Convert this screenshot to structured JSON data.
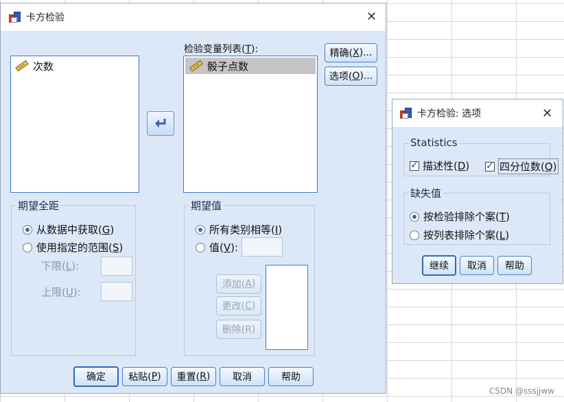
{
  "main_dialog": {
    "title": "卡方检验",
    "source_list": {
      "items": [
        "次数"
      ]
    },
    "test_var_label": "检验变量列表(",
    "test_var_key": "T",
    "test_var_suffix": "):",
    "test_var_list": {
      "items": [
        "骰子点数"
      ]
    },
    "side_buttons": [
      {
        "label": "精确(",
        "key": "X",
        "suffix": ")..."
      },
      {
        "label": "选项(",
        "key": "O",
        "suffix": ")..."
      }
    ],
    "expected_range": {
      "title": "期望全距",
      "option1": {
        "label": "从数据中获取(",
        "key": "G",
        "suffix": ")"
      },
      "option2": {
        "label": "使用指定的范围(",
        "key": "S",
        "suffix": ")"
      },
      "lower": {
        "label": "下限(",
        "key": "L",
        "suffix": "):"
      },
      "upper": {
        "label": "上限(",
        "key": "U",
        "suffix": "):"
      }
    },
    "expected_values": {
      "title": "期望值",
      "option1": {
        "label": "所有类别相等(",
        "key": "I",
        "suffix": ")"
      },
      "option2": {
        "label": "值(",
        "key": "V",
        "suffix": "):"
      },
      "add": {
        "label": "添加(",
        "key": "A",
        "suffix": ")"
      },
      "change": {
        "label": "更改(",
        "key": "C",
        "suffix": ")"
      },
      "remove": {
        "label": "删除(R)"
      }
    },
    "bottom_buttons": {
      "ok": "确定",
      "paste": {
        "label": "粘贴(",
        "key": "P",
        "suffix": ")"
      },
      "reset": {
        "label": "重置(",
        "key": "R",
        "suffix": ")"
      },
      "cancel": "取消",
      "help": "帮助"
    }
  },
  "options_dialog": {
    "title": "卡方检验: 选项",
    "statistics": {
      "title": "Statistics",
      "descriptive": {
        "label": "描述性(",
        "key": "D",
        "suffix": ")",
        "checked": true
      },
      "quartiles": {
        "label": "四分位数(",
        "key": "Q",
        "suffix": ")",
        "checked": true
      }
    },
    "missing": {
      "title": "缺失值",
      "option1": {
        "label": "按检验排除个案(",
        "key": "T",
        "suffix": ")"
      },
      "option2": {
        "label": "按列表排除个案(",
        "key": "L",
        "suffix": ")"
      }
    },
    "buttons": {
      "continue": "继续",
      "cancel": "取消",
      "help": "帮助"
    }
  },
  "watermark": "CSDN @sssjjww"
}
